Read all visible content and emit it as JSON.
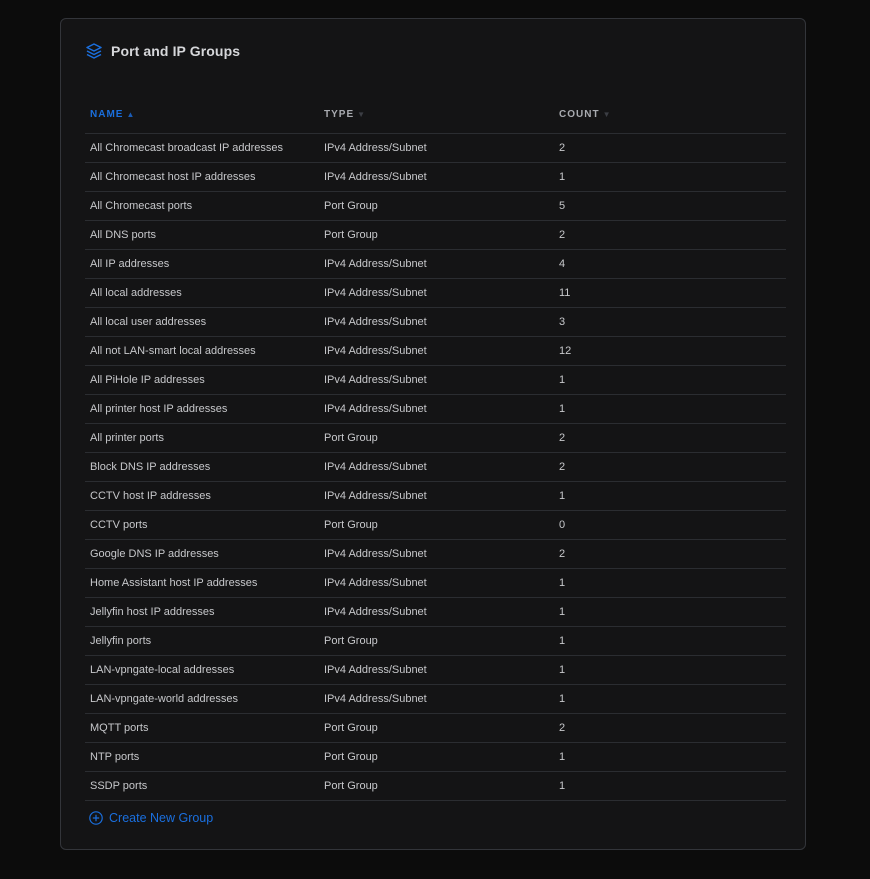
{
  "panel": {
    "title": "Port and IP Groups",
    "icon": "layers-icon",
    "accent_color": "#1a6fde"
  },
  "table": {
    "columns": [
      {
        "label": "NAME",
        "sorted": true,
        "sort_icon": "sort-asc-icon"
      },
      {
        "label": "TYPE",
        "sorted": false,
        "sort_icon": "sort-icon"
      },
      {
        "label": "COUNT",
        "sorted": false,
        "sort_icon": "sort-icon"
      }
    ],
    "rows": [
      {
        "name": "All Chromecast broadcast IP addresses",
        "type": "IPv4 Address/Subnet",
        "count": "2"
      },
      {
        "name": "All Chromecast host IP addresses",
        "type": "IPv4 Address/Subnet",
        "count": "1"
      },
      {
        "name": "All Chromecast ports",
        "type": "Port Group",
        "count": "5"
      },
      {
        "name": "All DNS ports",
        "type": "Port Group",
        "count": "2"
      },
      {
        "name": "All IP addresses",
        "type": "IPv4 Address/Subnet",
        "count": "4"
      },
      {
        "name": "All local addresses",
        "type": "IPv4 Address/Subnet",
        "count": "11"
      },
      {
        "name": "All local user addresses",
        "type": "IPv4 Address/Subnet",
        "count": "3"
      },
      {
        "name": "All not LAN-smart local addresses",
        "type": "IPv4 Address/Subnet",
        "count": "12"
      },
      {
        "name": "All PiHole IP addresses",
        "type": "IPv4 Address/Subnet",
        "count": "1"
      },
      {
        "name": "All printer host IP addresses",
        "type": "IPv4 Address/Subnet",
        "count": "1"
      },
      {
        "name": "All printer ports",
        "type": "Port Group",
        "count": "2"
      },
      {
        "name": "Block DNS IP addresses",
        "type": "IPv4 Address/Subnet",
        "count": "2"
      },
      {
        "name": "CCTV host IP addresses",
        "type": "IPv4 Address/Subnet",
        "count": "1"
      },
      {
        "name": "CCTV ports",
        "type": "Port Group",
        "count": "0"
      },
      {
        "name": "Google DNS IP addresses",
        "type": "IPv4 Address/Subnet",
        "count": "2"
      },
      {
        "name": "Home Assistant host IP addresses",
        "type": "IPv4 Address/Subnet",
        "count": "1"
      },
      {
        "name": "Jellyfin host IP addresses",
        "type": "IPv4 Address/Subnet",
        "count": "1"
      },
      {
        "name": "Jellyfin ports",
        "type": "Port Group",
        "count": "1"
      },
      {
        "name": "LAN-vpngate-local addresses",
        "type": "IPv4 Address/Subnet",
        "count": "1"
      },
      {
        "name": "LAN-vpngate-world addresses",
        "type": "IPv4 Address/Subnet",
        "count": "1"
      },
      {
        "name": "MQTT ports",
        "type": "Port Group",
        "count": "2"
      },
      {
        "name": "NTP ports",
        "type": "Port Group",
        "count": "1"
      },
      {
        "name": "SSDP ports",
        "type": "Port Group",
        "count": "1"
      }
    ]
  },
  "actions": {
    "create_label": "Create New Group",
    "create_icon": "plus-circle-icon"
  }
}
